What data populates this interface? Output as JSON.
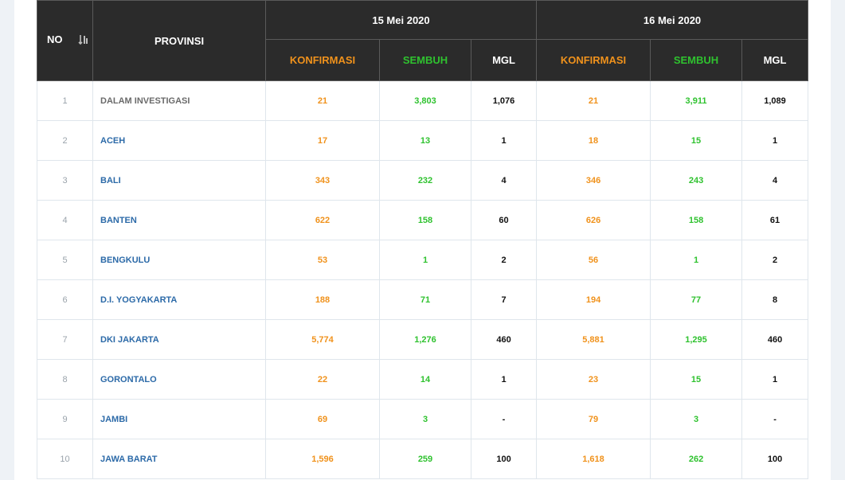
{
  "header": {
    "no": "NO",
    "provinsi": "PROVINSI",
    "date1": "15 Mei 2020",
    "date2": "16 Mei 2020",
    "konfirmasi": "KONFIRMASI",
    "sembuh": "SEMBUH",
    "mgl": "MGL",
    "sort_icon": "sort-icon"
  },
  "colors": {
    "header_bg": "#2b2b2b",
    "konfirmasi": "#f0921c",
    "sembuh": "#2fc22f",
    "link": "#2c6aa8"
  },
  "rows": [
    {
      "no": "1",
      "prov": "DALAM INVESTIGASI",
      "k1": "21",
      "s1": "3,803",
      "m1": "1,076",
      "k2": "21",
      "s2": "3,911",
      "m2": "1,089"
    },
    {
      "no": "2",
      "prov": "ACEH",
      "k1": "17",
      "s1": "13",
      "m1": "1",
      "k2": "18",
      "s2": "15",
      "m2": "1"
    },
    {
      "no": "3",
      "prov": "BALI",
      "k1": "343",
      "s1": "232",
      "m1": "4",
      "k2": "346",
      "s2": "243",
      "m2": "4"
    },
    {
      "no": "4",
      "prov": "BANTEN",
      "k1": "622",
      "s1": "158",
      "m1": "60",
      "k2": "626",
      "s2": "158",
      "m2": "61"
    },
    {
      "no": "5",
      "prov": "BENGKULU",
      "k1": "53",
      "s1": "1",
      "m1": "2",
      "k2": "56",
      "s2": "1",
      "m2": "2"
    },
    {
      "no": "6",
      "prov": "D.I. YOGYAKARTA",
      "k1": "188",
      "s1": "71",
      "m1": "7",
      "k2": "194",
      "s2": "77",
      "m2": "8"
    },
    {
      "no": "7",
      "prov": "DKI JAKARTA",
      "k1": "5,774",
      "s1": "1,276",
      "m1": "460",
      "k2": "5,881",
      "s2": "1,295",
      "m2": "460"
    },
    {
      "no": "8",
      "prov": "GORONTALO",
      "k1": "22",
      "s1": "14",
      "m1": "1",
      "k2": "23",
      "s2": "15",
      "m2": "1"
    },
    {
      "no": "9",
      "prov": "JAMBI",
      "k1": "69",
      "s1": "3",
      "m1": "-",
      "k2": "79",
      "s2": "3",
      "m2": "-"
    },
    {
      "no": "10",
      "prov": "JAWA BARAT",
      "k1": "1,596",
      "s1": "259",
      "m1": "100",
      "k2": "1,618",
      "s2": "262",
      "m2": "100"
    }
  ]
}
